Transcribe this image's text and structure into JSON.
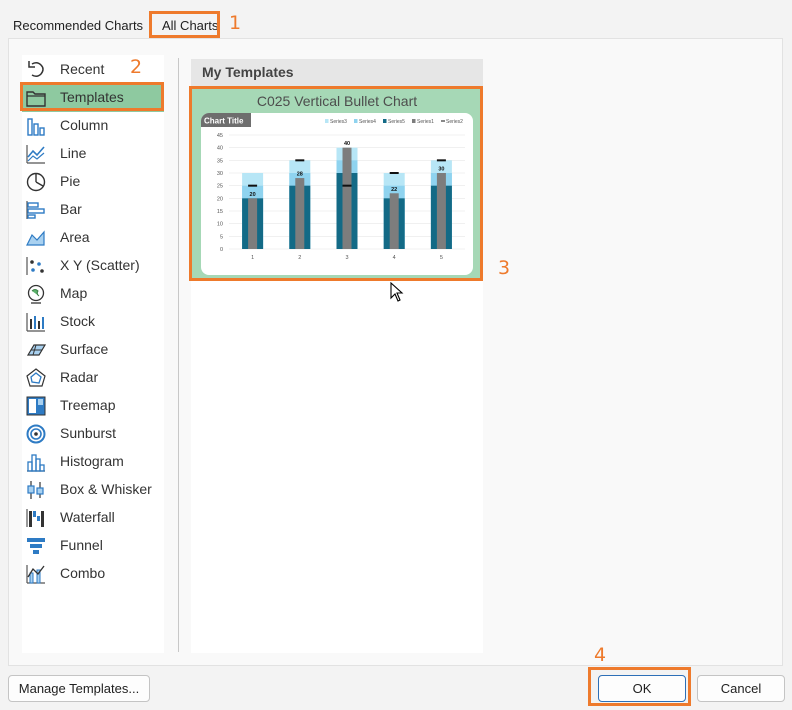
{
  "tabs": [
    {
      "label": "Recommended Charts"
    },
    {
      "label": "All Charts",
      "selected": true
    }
  ],
  "annotations": {
    "color": "#ee7a2c",
    "steps": [
      "1",
      "2",
      "3",
      "4"
    ]
  },
  "sidebar": {
    "selected_color": "#8ec9a0",
    "items": [
      {
        "label": "Recent",
        "icon": "recent-icon"
      },
      {
        "label": "Templates",
        "icon": "folder-icon",
        "selected": true
      },
      {
        "label": "Column",
        "icon": "column-chart-icon"
      },
      {
        "label": "Line",
        "icon": "line-chart-icon"
      },
      {
        "label": "Pie",
        "icon": "pie-chart-icon"
      },
      {
        "label": "Bar",
        "icon": "bar-chart-icon"
      },
      {
        "label": "Area",
        "icon": "area-chart-icon"
      },
      {
        "label": "X Y (Scatter)",
        "icon": "scatter-chart-icon"
      },
      {
        "label": "Map",
        "icon": "map-chart-icon"
      },
      {
        "label": "Stock",
        "icon": "stock-chart-icon"
      },
      {
        "label": "Surface",
        "icon": "surface-chart-icon"
      },
      {
        "label": "Radar",
        "icon": "radar-chart-icon"
      },
      {
        "label": "Treemap",
        "icon": "treemap-chart-icon"
      },
      {
        "label": "Sunburst",
        "icon": "sunburst-chart-icon"
      },
      {
        "label": "Histogram",
        "icon": "histogram-chart-icon"
      },
      {
        "label": "Box & Whisker",
        "icon": "box-whisker-chart-icon"
      },
      {
        "label": "Waterfall",
        "icon": "waterfall-chart-icon"
      },
      {
        "label": "Funnel",
        "icon": "funnel-chart-icon"
      },
      {
        "label": "Combo",
        "icon": "combo-chart-icon"
      }
    ]
  },
  "content": {
    "header": "My Templates",
    "template": {
      "name": "C025 Vertical Bullet Chart"
    }
  },
  "chart_data": {
    "type": "bar",
    "title": "Chart Title",
    "categories": [
      "1",
      "2",
      "3",
      "4",
      "5"
    ],
    "ylim": [
      0,
      45
    ],
    "yticks": [
      0,
      5,
      10,
      15,
      20,
      25,
      30,
      35,
      40,
      45
    ],
    "grid": true,
    "legend_position": "top-right",
    "series": [
      {
        "name": "Series3",
        "color": "#b7e6f6",
        "values": [
          30,
          35,
          40,
          30,
          35
        ]
      },
      {
        "name": "Series4",
        "color": "#8fd3ef",
        "values": [
          25,
          30,
          35,
          25,
          30
        ]
      },
      {
        "name": "Series5",
        "color": "#136a86",
        "values": [
          20,
          25,
          30,
          20,
          25
        ]
      },
      {
        "name": "Series1",
        "color": "#7d7d7d",
        "values": [
          20,
          28,
          40,
          22,
          30
        ]
      },
      {
        "name": "Series2",
        "color": "#111111",
        "values": [
          25,
          35,
          25,
          30,
          35
        ]
      }
    ],
    "data_labels": [
      "20",
      "28",
      "40",
      "22",
      "30"
    ]
  },
  "buttons": {
    "manage": "Manage Templates...",
    "ok": "OK",
    "cancel": "Cancel"
  }
}
